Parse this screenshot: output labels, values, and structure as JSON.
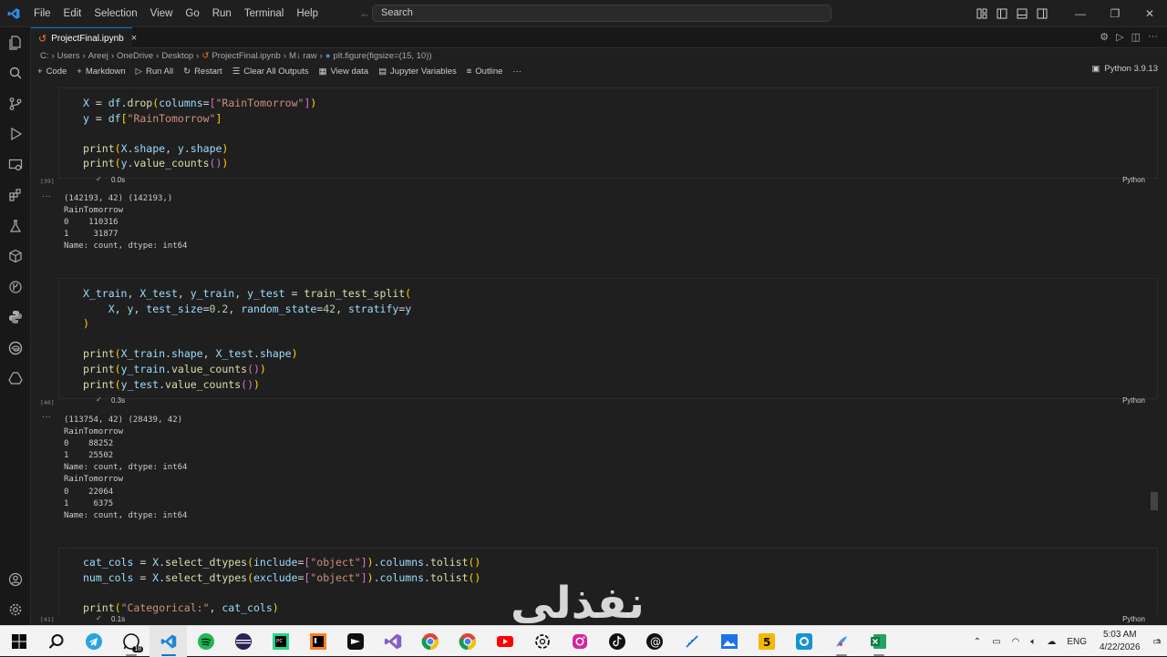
{
  "menu": [
    "File",
    "Edit",
    "Selection",
    "View",
    "Go",
    "Run",
    "Terminal",
    "Help"
  ],
  "search": {
    "label": "Search"
  },
  "tab": {
    "name": "ProjectFinal.ipynb",
    "close": "×"
  },
  "breadcrumb": [
    "C:",
    "Users",
    "Areej",
    "OneDrive",
    "Desktop",
    "ProjectFinal.ipynb",
    "M↓ raw",
    "plt.figure(figsize=(15, 10))"
  ],
  "toolbar": {
    "code": "Code",
    "markdown": "Markdown",
    "run_all": "Run All",
    "restart": "Restart",
    "clear_outputs": "Clear All Outputs",
    "view_data": "View data",
    "jupyter_variables": "Jupyter Variables",
    "outline": "Outline",
    "more": "···",
    "kernel": "Python 3.9.13"
  },
  "cells": [
    {
      "exec": "[39]",
      "time": "0.0s",
      "lang": "Python",
      "output": "(142193, 42) (142193,)\nRainTomorrow\n0    110316\n1     31877\nName: count, dtype: int64"
    },
    {
      "exec": "[40]",
      "time": "0.3s",
      "lang": "Python",
      "output": "(113754, 42) (28439, 42)\nRainTomorrow\n0    88252\n1    25502\nName: count, dtype: int64\nRainTomorrow\n0    22064\n1     6375\nName: count, dtype: int64"
    },
    {
      "exec": "[41]",
      "time": "0.1s",
      "lang": "Python"
    }
  ],
  "output_dots": "···",
  "watermark": "نفذلي",
  "taskbar": {
    "whatsapp_badge": "18",
    "lang": "ENG",
    "time": "5:03 AM",
    "date": "4/22/2026",
    "notif": "3"
  },
  "colors": {
    "accent": "#0078d4",
    "bg": "#1f1f1f",
    "check": "#89d185"
  }
}
